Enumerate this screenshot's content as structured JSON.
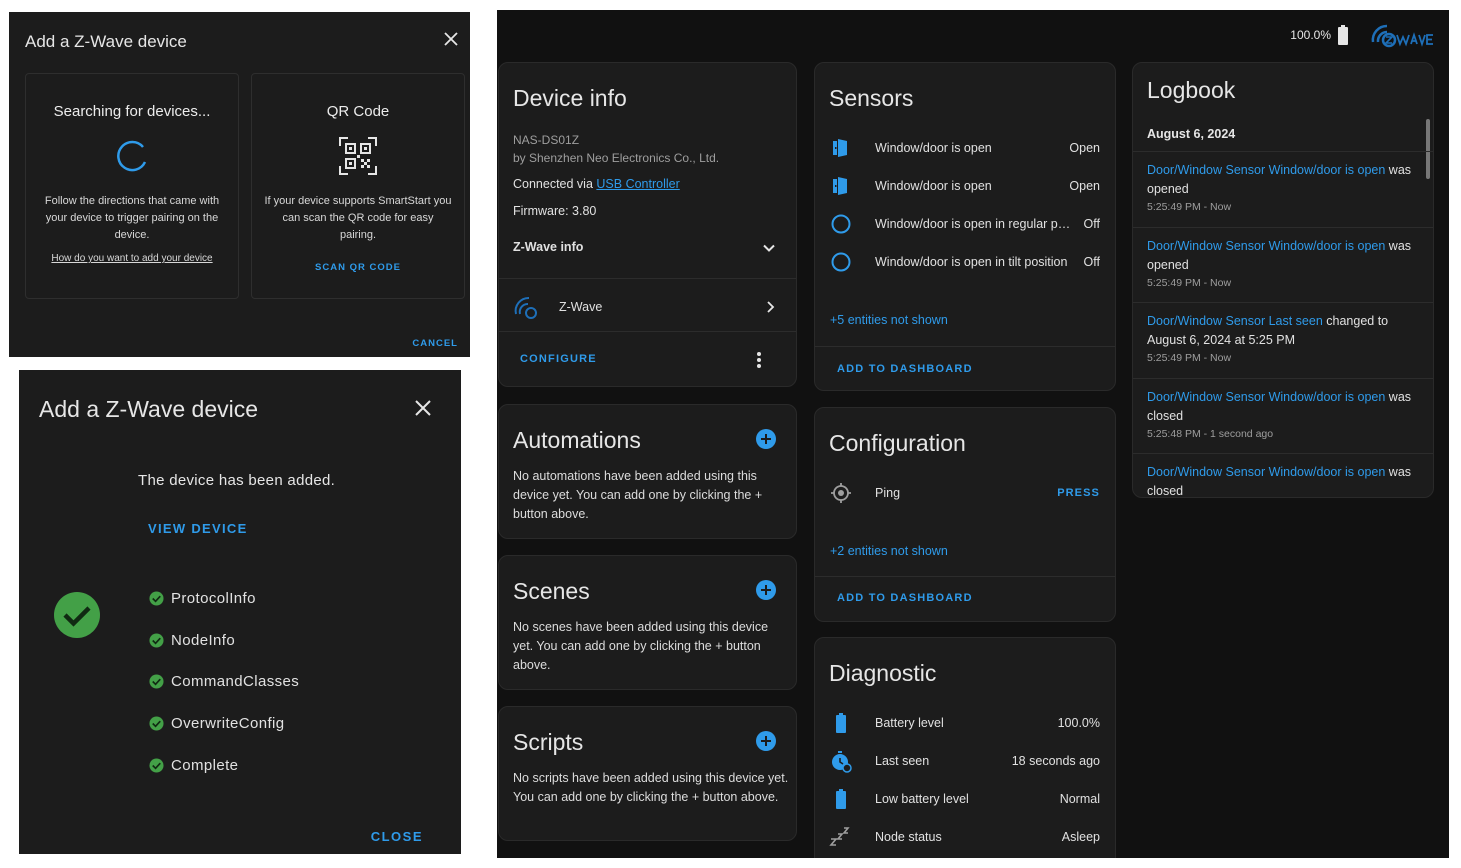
{
  "dialog1": {
    "title": "Add a Z-Wave device",
    "search": {
      "heading": "Searching for devices...",
      "text": "Follow the directions that came with your device to trigger pairing on the device.",
      "link": "How do you want to add your device"
    },
    "qr": {
      "heading": "QR Code",
      "text": "If your device supports SmartStart you can scan the QR code for easy pairing.",
      "button": "SCAN QR CODE"
    },
    "cancel": "CANCEL"
  },
  "dialog2": {
    "title": "Add a Z-Wave device",
    "message": "The device has been added.",
    "view_device": "VIEW DEVICE",
    "steps": [
      "ProtocolInfo",
      "NodeInfo",
      "CommandClasses",
      "OverwriteConfig",
      "Complete"
    ],
    "close": "CLOSE",
    "success_color": "#43a047"
  },
  "topbar": {
    "battery": "100.0%"
  },
  "device_info": {
    "title": "Device info",
    "model": "NAS-DS01Z",
    "manufacturer": "by Shenzhen Neo Electronics Co., Ltd.",
    "connected_prefix": "Connected via",
    "connected_link": "USB Controller",
    "firmware": "Firmware: 3.80",
    "zwave_info": "Z-Wave info",
    "integration": "Z-Wave",
    "configure": "CONFIGURE"
  },
  "automations": {
    "title": "Automations",
    "text": "No automations have been added using this device yet. You can add one by clicking the + button above."
  },
  "scenes": {
    "title": "Scenes",
    "text": "No scenes have been added using this device yet. You can add one by clicking the + button above."
  },
  "scripts": {
    "title": "Scripts",
    "text": "No scripts have been added using this device yet. You can add one by clicking the + button above."
  },
  "sensors": {
    "title": "Sensors",
    "rows": [
      {
        "name": "Window/door is open",
        "value": "Open",
        "icon": "door-open-icon"
      },
      {
        "name": "Window/door is open",
        "value": "Open",
        "icon": "door-open-icon"
      },
      {
        "name": "Window/door is open in regular position",
        "value": "Off",
        "icon": "circle-off-icon"
      },
      {
        "name": "Window/door is open in tilt position",
        "value": "Off",
        "icon": "circle-off-icon"
      }
    ],
    "hidden": "+5 entities not shown",
    "add": "ADD TO DASHBOARD"
  },
  "configuration": {
    "title": "Configuration",
    "ping": "Ping",
    "press": "PRESS",
    "hidden": "+2 entities not shown",
    "add": "ADD TO DASHBOARD"
  },
  "diagnostic": {
    "title": "Diagnostic",
    "rows": [
      {
        "name": "Battery level",
        "value": "100.0%",
        "icon": "battery-icon"
      },
      {
        "name": "Last seen",
        "value": "18 seconds ago",
        "icon": "clock-icon"
      },
      {
        "name": "Low battery level",
        "value": "Normal",
        "icon": "battery-icon"
      },
      {
        "name": "Node status",
        "value": "Asleep",
        "icon": "sleep-icon"
      }
    ]
  },
  "logbook": {
    "title": "Logbook",
    "date": "August 6, 2024",
    "entries": [
      {
        "entity": "Door/Window Sensor Window/door is open",
        "action": "was opened",
        "time": "5:25:49 PM - Now"
      },
      {
        "entity": "Door/Window Sensor Window/door is open",
        "action": "was opened",
        "time": "5:25:49 PM - Now"
      },
      {
        "entity": "Door/Window Sensor Last seen",
        "action": "changed to August 6, 2024 at 5:25 PM",
        "time": "5:25:49 PM - Now"
      },
      {
        "entity": "Door/Window Sensor Window/door is open",
        "action": "was closed",
        "time": "5:25:48 PM - 1 second ago"
      },
      {
        "entity": "Door/Window Sensor Window/door is open",
        "action": "was closed",
        "time": ""
      }
    ]
  },
  "colors": {
    "accent": "#2f9bea",
    "card": "#1c1c1c",
    "background": "#111111",
    "success": "#43a047"
  }
}
